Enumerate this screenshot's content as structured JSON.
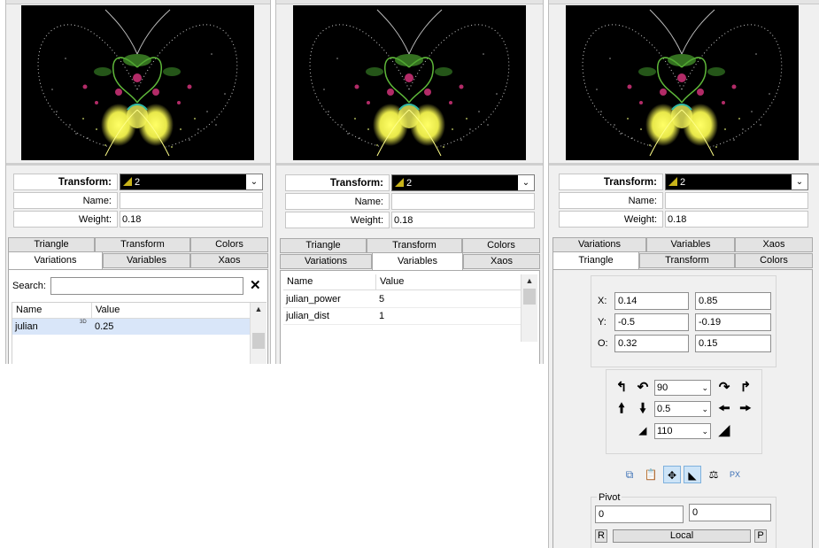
{
  "panels": [
    {
      "transform": {
        "label": "Transform:",
        "value": "2"
      },
      "name": {
        "label": "Name:",
        "value": ""
      },
      "weight": {
        "label": "Weight:",
        "value": "0.18"
      },
      "tabs_back": [
        "Triangle",
        "Transform",
        "Colors"
      ],
      "tabs_front": [
        "Variations",
        "Variables",
        "Xaos"
      ],
      "search_label": "Search:",
      "clear_icon": "close-icon",
      "table": {
        "headers": [
          "Name",
          "Value"
        ],
        "rows": [
          {
            "name": "julian",
            "badge": "3D",
            "value": "0.25"
          }
        ]
      }
    },
    {
      "transform": {
        "label": "Transform:",
        "value": "2"
      },
      "name": {
        "label": "Name:",
        "value": ""
      },
      "weight": {
        "label": "Weight:",
        "value": "0.18"
      },
      "tabs_back": [
        "Triangle",
        "Transform",
        "Colors"
      ],
      "tabs_front": [
        "Variations",
        "Variables",
        "Xaos"
      ],
      "table": {
        "headers": [
          "Name",
          "Value"
        ],
        "rows": [
          {
            "name": "julian_power",
            "value": "5"
          },
          {
            "name": "julian_dist",
            "value": "1"
          }
        ]
      }
    },
    {
      "transform": {
        "label": "Transform:",
        "value": "2"
      },
      "name": {
        "label": "Name:",
        "value": ""
      },
      "weight": {
        "label": "Weight:",
        "value": "0.18"
      },
      "tabs_back": [
        "Variations",
        "Variables",
        "Xaos"
      ],
      "tabs_front": [
        "Triangle",
        "Transform",
        "Colors"
      ],
      "coords": [
        {
          "label": "X:",
          "a": "0.14",
          "b": "0.85"
        },
        {
          "label": "Y:",
          "a": "-0.5",
          "b": "-0.19"
        },
        {
          "label": "O:",
          "a": "0.32",
          "b": "0.15"
        }
      ],
      "rotate_value": "90",
      "move_value": "0.5",
      "scale_value": "110",
      "pivot": {
        "label": "Pivot",
        "x": "0",
        "y": "0",
        "reset_label": "R",
        "mode_label": "Local",
        "pick_label": "P"
      }
    }
  ]
}
